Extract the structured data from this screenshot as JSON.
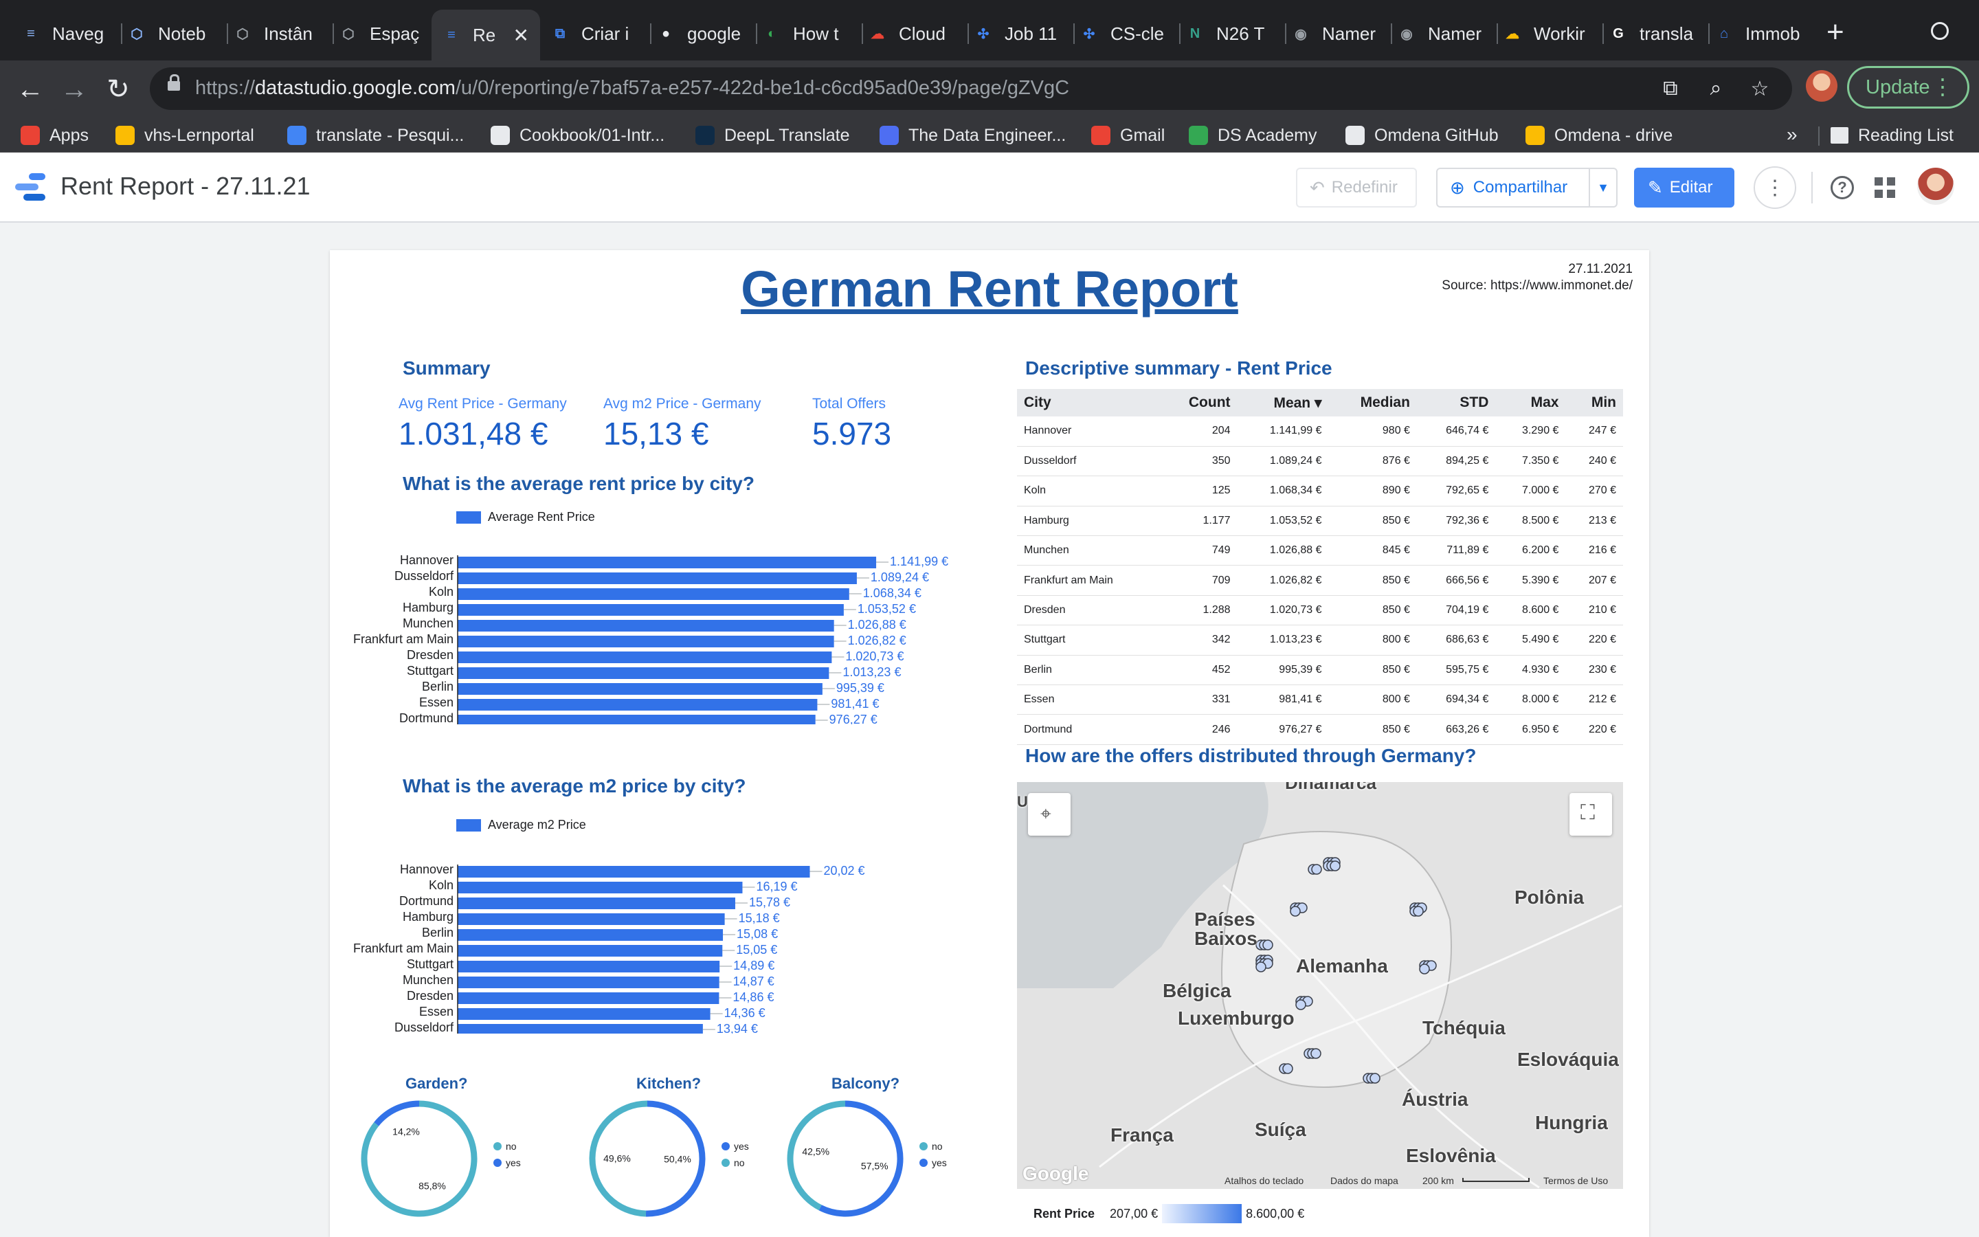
{
  "browser": {
    "tabs": [
      {
        "label": "Naveg",
        "fav_color": "#8ab4f8",
        "fav_glyph": "≡"
      },
      {
        "label": "Noteb",
        "fav_color": "#8ab4f8",
        "fav_glyph": "⬡"
      },
      {
        "label": "Instân",
        "fav_color": "#9aa0a6",
        "fav_glyph": "⬡"
      },
      {
        "label": "Espaç",
        "fav_color": "#9aa0a6",
        "fav_glyph": "⬡"
      },
      {
        "label": "Re",
        "fav_color": "#4285f4",
        "fav_glyph": "≡",
        "active": true
      },
      {
        "label": "Criar i",
        "fav_color": "#4285f4",
        "fav_glyph": "⧉"
      },
      {
        "label": "google",
        "fav_color": "#e8eaed",
        "fav_glyph": "●"
      },
      {
        "label": "How t",
        "fav_color": "#34a853",
        "fav_glyph": "◐"
      },
      {
        "label": "Cloud",
        "fav_color": "#ea4335",
        "fav_glyph": "☁"
      },
      {
        "label": "Job 11",
        "fav_color": "#4285f4",
        "fav_glyph": "✣"
      },
      {
        "label": "CS-cle",
        "fav_color": "#4285f4",
        "fav_glyph": "✣"
      },
      {
        "label": "N26 T",
        "fav_color": "#36a18b",
        "fav_glyph": "N"
      },
      {
        "label": "Namer",
        "fav_color": "#9aa0a6",
        "fav_glyph": "◉"
      },
      {
        "label": "Namer",
        "fav_color": "#9aa0a6",
        "fav_glyph": "◉"
      },
      {
        "label": "Workir",
        "fav_color": "#fbbc04",
        "fav_glyph": "☁"
      },
      {
        "label": "transla",
        "fav_color": "#ffffff",
        "fav_glyph": "G"
      },
      {
        "label": "Immob",
        "fav_color": "#4285f4",
        "fav_glyph": "⌂"
      }
    ],
    "url_prefix": "https://",
    "url_domain": "datastudio.google.com",
    "url_path": "/u/0/reporting/e7baf57a-e257-422d-be1d-c6cd95ad0e39/page/gZVgC",
    "update_label": "Update",
    "bookmarks": [
      {
        "label": "Apps",
        "color": "#ea4335"
      },
      {
        "label": "vhs-Lernportal",
        "color": "#fbbc04"
      },
      {
        "label": "translate - Pesqui...",
        "color": "#4285f4"
      },
      {
        "label": "Cookbook/01-Intr...",
        "color": "#e8eaed"
      },
      {
        "label": "DeepL Translate",
        "color": "#0f2b46"
      },
      {
        "label": "The Data Engineer...",
        "color": "#4e6ef2"
      },
      {
        "label": "Gmail",
        "color": "#ea4335"
      },
      {
        "label": "DS Academy",
        "color": "#34a853"
      },
      {
        "label": "Omdena GitHub",
        "color": "#e8eaed"
      },
      {
        "label": "Omdena - drive",
        "color": "#fbbc04"
      }
    ],
    "bookmarks_more": "»",
    "reading_list": "Reading List"
  },
  "app": {
    "report_title": "Rent Report - 27.11.21",
    "reset_label": "Redefinir",
    "share_label": "Compartilhar",
    "edit_label": "Editar"
  },
  "report": {
    "title": "German Rent Report",
    "date": "27.11.2021",
    "source": "Source: https://www.immonet.de/",
    "summary_title": "Summary",
    "kpis": [
      {
        "label": "Avg Rent Price - Germany",
        "value": "1.031,48 €"
      },
      {
        "label": "Avg m2 Price - Germany",
        "value": "15,13 €"
      },
      {
        "label": "Total Offers",
        "value": "5.973"
      }
    ],
    "q_rent": "What is the average rent price by city?",
    "q_m2": "What is the average m2 price by city?",
    "q_table": "Descriptive summary - Rent Price",
    "q_map": "How are the offers distributed through Germany?",
    "donut_titles": [
      "Garden?",
      "Kitchen?",
      "Balcony?"
    ]
  },
  "chart_data": [
    {
      "type": "bar",
      "orientation": "horizontal",
      "legend": "Average Rent Price",
      "categories": [
        "Hannover",
        "Dusseldorf",
        "Koln",
        "Hamburg",
        "Munchen",
        "Frankfurt am Main",
        "Dresden",
        "Stuttgart",
        "Berlin",
        "Essen",
        "Dortmund"
      ],
      "values": [
        1141.99,
        1089.24,
        1068.34,
        1053.52,
        1026.88,
        1026.82,
        1020.73,
        1013.23,
        995.39,
        981.41,
        976.27
      ],
      "labels": [
        "1.141,99 €",
        "1.089,24 €",
        "1.068,34 €",
        "1.053,52 €",
        "1.026,88 €",
        "1.026,82 €",
        "1.020,73 €",
        "1.013,23 €",
        "995,39 €",
        "981,41 €",
        "976,27 €"
      ],
      "xlim": [
        0,
        1200
      ],
      "ticks": [
        0,
        200,
        400,
        600,
        800,
        1000,
        1200
      ],
      "tick_labels": [
        "0",
        "200",
        "400",
        "600",
        "800",
        "1 mil",
        "1,2 mil"
      ],
      "color": "#3272e8"
    },
    {
      "type": "bar",
      "orientation": "horizontal",
      "legend": "Average m2 Price",
      "categories": [
        "Hannover",
        "Koln",
        "Dortmund",
        "Hamburg",
        "Berlin",
        "Frankfurt am Main",
        "Stuttgart",
        "Munchen",
        "Dresden",
        "Essen",
        "Dusseldorf"
      ],
      "values": [
        20.02,
        16.19,
        15.78,
        15.18,
        15.08,
        15.05,
        14.89,
        14.87,
        14.86,
        14.36,
        13.94
      ],
      "labels": [
        "20,02 €",
        "16,19 €",
        "15,78 €",
        "15,18 €",
        "15,08 €",
        "15,05 €",
        "14,89 €",
        "14,87 €",
        "14,86 €",
        "14,36 €",
        "13,94 €"
      ],
      "xlim": [
        0,
        25
      ],
      "ticks": [
        0,
        5,
        10,
        15,
        20,
        25
      ],
      "tick_labels": [
        "0",
        "5",
        "10",
        "15",
        "20",
        "25"
      ],
      "color": "#3272e8"
    },
    {
      "type": "pie",
      "donut": true,
      "slices": [
        {
          "name": "no",
          "value": 85.8,
          "label": "85,8%",
          "color": "#4db3c9"
        },
        {
          "name": "yes",
          "value": 14.2,
          "label": "14,2%",
          "color": "#3272e8"
        }
      ],
      "legend_order": [
        "no",
        "yes"
      ]
    },
    {
      "type": "pie",
      "donut": true,
      "slices": [
        {
          "name": "yes",
          "value": 50.4,
          "label": "50,4%",
          "color": "#3272e8"
        },
        {
          "name": "no",
          "value": 49.6,
          "label": "49,6%",
          "color": "#4db3c9"
        }
      ],
      "legend_order": [
        "yes",
        "no"
      ]
    },
    {
      "type": "pie",
      "donut": true,
      "slices": [
        {
          "name": "yes",
          "value": 57.5,
          "label": "57,5%",
          "color": "#3272e8"
        },
        {
          "name": "no",
          "value": 42.5,
          "label": "42,5%",
          "color": "#4db3c9"
        }
      ],
      "legend_order": [
        "no",
        "yes"
      ]
    },
    {
      "type": "table",
      "columns": [
        "City",
        "Count",
        "Mean ▾",
        "Median",
        "STD",
        "Max",
        "Min"
      ],
      "rows": [
        [
          "Hannover",
          "204",
          "1.141,99 €",
          "980 €",
          "646,74 €",
          "3.290 €",
          "247 €"
        ],
        [
          "Dusseldorf",
          "350",
          "1.089,24 €",
          "876 €",
          "894,25 €",
          "7.350 €",
          "240 €"
        ],
        [
          "Koln",
          "125",
          "1.068,34 €",
          "890 €",
          "792,65 €",
          "7.000 €",
          "270 €"
        ],
        [
          "Hamburg",
          "1.177",
          "1.053,52 €",
          "850 €",
          "792,36 €",
          "8.500 €",
          "213 €"
        ],
        [
          "Munchen",
          "749",
          "1.026,88 €",
          "845 €",
          "711,89 €",
          "6.200 €",
          "216 €"
        ],
        [
          "Frankfurt am Main",
          "709",
          "1.026,82 €",
          "850 €",
          "666,56 €",
          "5.390 €",
          "207 €"
        ],
        [
          "Dresden",
          "1.288",
          "1.020,73 €",
          "850 €",
          "704,19 €",
          "8.600 €",
          "210 €"
        ],
        [
          "Stuttgart",
          "342",
          "1.013,23 €",
          "800 €",
          "686,63 €",
          "5.490 €",
          "220 €"
        ],
        [
          "Berlin",
          "452",
          "995,39 €",
          "850 €",
          "595,75 €",
          "4.930 €",
          "230 €"
        ],
        [
          "Essen",
          "331",
          "981,41 €",
          "800 €",
          "694,34 €",
          "8.000 €",
          "212 €"
        ],
        [
          "Dortmund",
          "246",
          "976,27 €",
          "850 €",
          "663,26 €",
          "6.950 €",
          "220 €"
        ]
      ]
    }
  ],
  "map": {
    "labels": [
      "Dinamarca",
      "Polônia",
      "Países",
      "Baixos",
      "Alemanha",
      "Bélgica",
      "Luxemburgo",
      "Tchéquia",
      "Eslováquia",
      "Áustria",
      "Hungria",
      "França",
      "Suíça",
      "Eslovênia",
      "U"
    ],
    "logo": "Google",
    "footer": [
      "Atalhos do teclado",
      "Dados do mapa",
      "200 km",
      "Termos de Uso"
    ],
    "legend_title": "Rent Price",
    "legend_min": "207,00 €",
    "legend_max": "8.600,00 €"
  }
}
